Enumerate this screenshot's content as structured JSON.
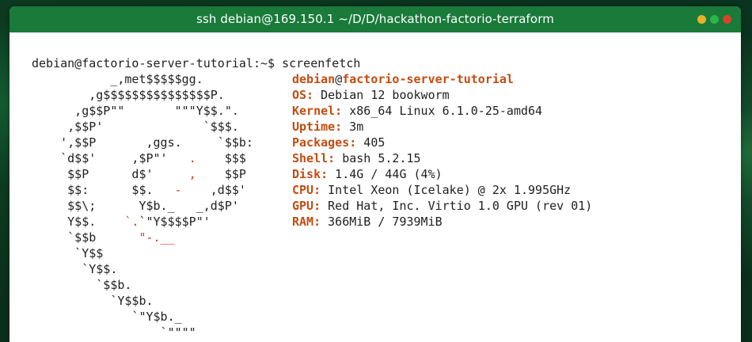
{
  "window": {
    "title": "ssh debian@169.150.1 ~/D/D/hackathon-factorio-terraform",
    "controls": [
      {
        "name": "minimize",
        "color": "#e8b02a"
      },
      {
        "name": "maximize",
        "color": "#2db34a"
      },
      {
        "name": "close",
        "color": "#d9432a"
      }
    ]
  },
  "terminal": {
    "prompt": "debian@factorio-server-tutorial:~$ screenfetch",
    "logo_lines": [
      [
        "           _,met$$$$$gg.",
        ""
      ],
      [
        "        ,g$$$$$$$$$$$$$$$P.",
        ""
      ],
      [
        "      ,g$$P\"\"       \"\"\"Y$$.\".",
        ""
      ],
      [
        "     ,$$P'              `$$$.",
        ""
      ],
      [
        "    ',$$P       ,ggs.     `$$b:",
        ""
      ],
      [
        "    `d$$'     ,$P\"'   ",
        ".",
        "    $$$"
      ],
      [
        "     $$P      d$'     ",
        ",",
        "    $$P"
      ],
      [
        "     $$:      $$.   ",
        "-",
        "    ,d$$'"
      ],
      [
        "     $$\\;      Y$b._   _,d$P'",
        ""
      ],
      [
        "     Y$$.    ",
        "`.",
        "`\"Y$$$$P\"'"
      ],
      [
        "     `$$b      ",
        "\"-.__",
        ""
      ],
      [
        "      `Y$$",
        ""
      ],
      [
        "       `Y$$.",
        ""
      ],
      [
        "         `$$b.",
        ""
      ],
      [
        "           `Y$$b.",
        ""
      ],
      [
        "              `\"Y$b._",
        ""
      ],
      [
        "                  `\"\"\"\"",
        ""
      ]
    ],
    "user": "debian",
    "at": "@",
    "host": "factorio-server-tutorial",
    "info": [
      {
        "label": "OS:",
        "value": " Debian 12 bookworm"
      },
      {
        "label": "Kernel:",
        "value": " x86_64 Linux 6.1.0-25-amd64"
      },
      {
        "label": "Uptime:",
        "value": " 3m"
      },
      {
        "label": "Packages:",
        "value": " 405"
      },
      {
        "label": "Shell:",
        "value": " bash 5.2.15"
      },
      {
        "label": "Disk:",
        "value": " 1.4G / 44G (4%)"
      },
      {
        "label": "CPU:",
        "value": " Intel Xeon (Icelake) @ 2x 1.995GHz"
      },
      {
        "label": "GPU:",
        "value": " Red Hat, Inc. Virtio 1.0 GPU (rev 01)"
      },
      {
        "label": "RAM:",
        "value": " 366MiB / 7939MiB"
      }
    ]
  }
}
